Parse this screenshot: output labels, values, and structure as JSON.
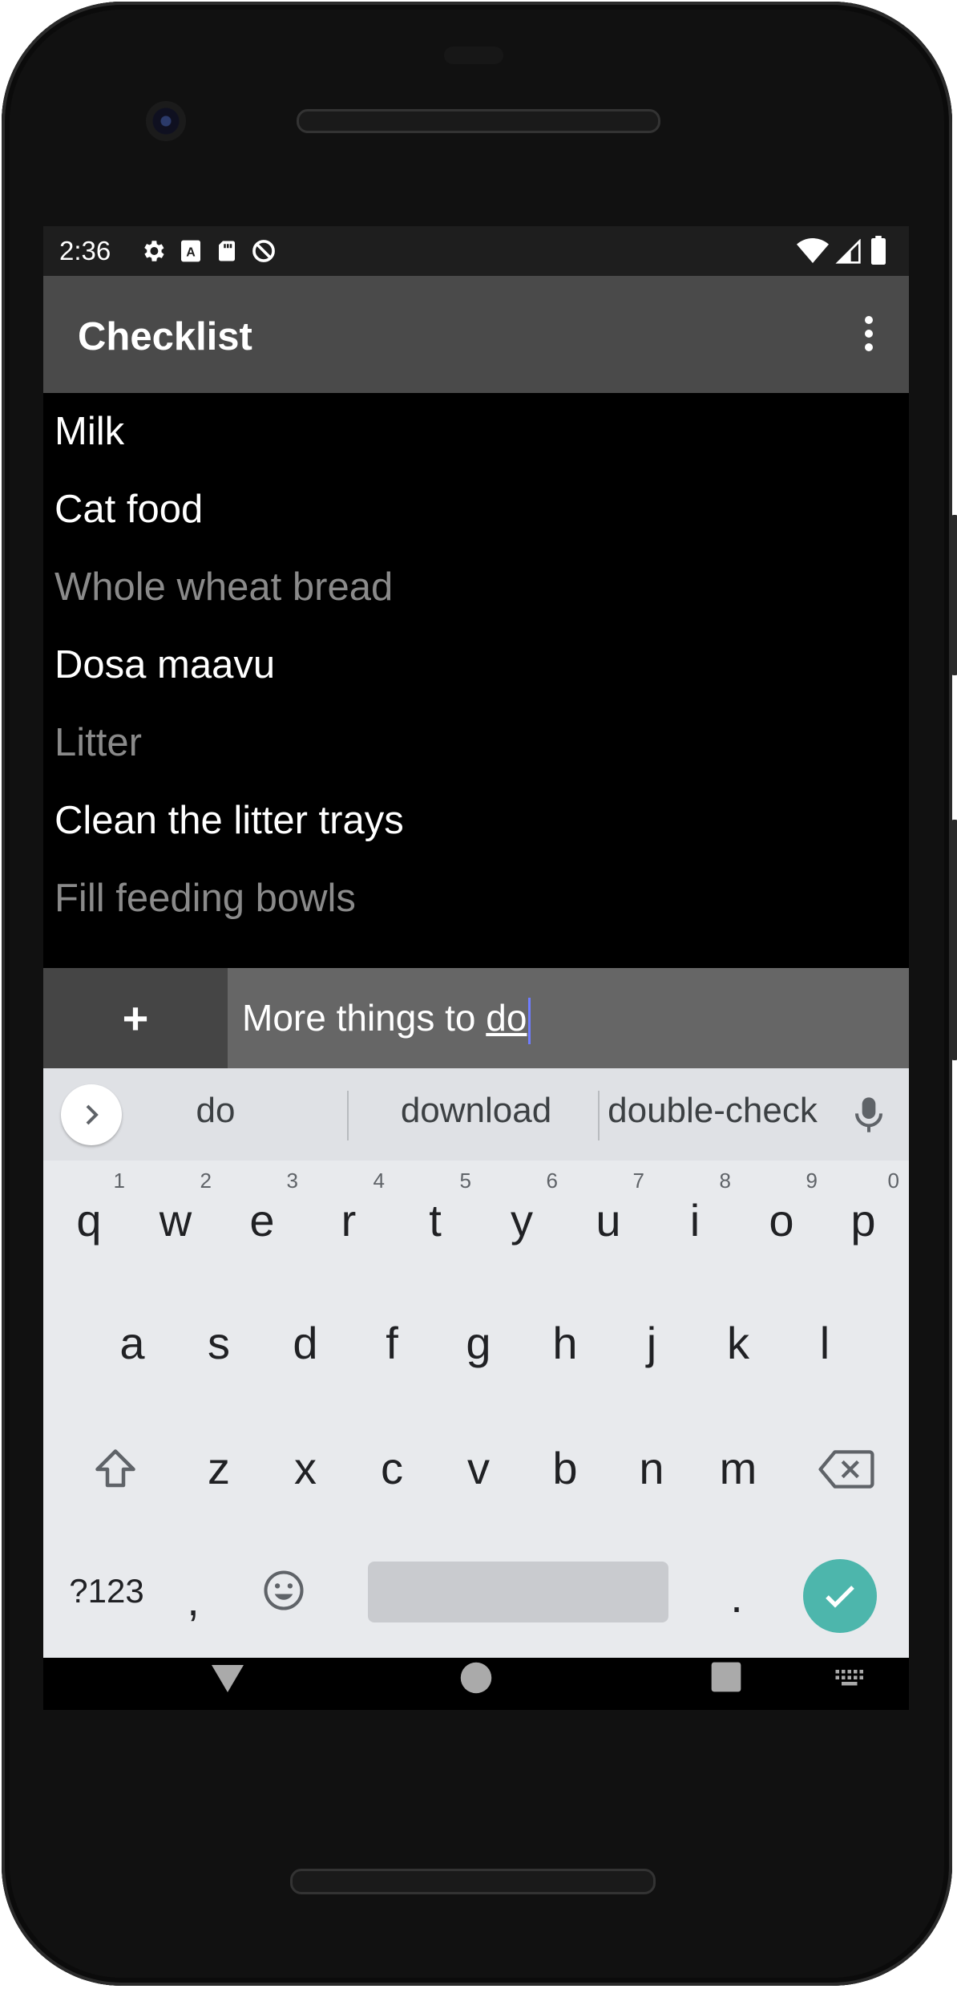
{
  "status_bar": {
    "time": "2:36",
    "left_icons": [
      "gear-icon",
      "a-keyboard-icon",
      "sd-card-icon",
      "no-sync-icon"
    ],
    "right_icons": [
      "wifi-icon",
      "signal-icon",
      "battery-icon"
    ]
  },
  "app_bar": {
    "title": "Checklist",
    "menu_icon": "more-vert-icon"
  },
  "list": {
    "items": [
      {
        "label": "Milk",
        "checked": false
      },
      {
        "label": "Cat food",
        "checked": false
      },
      {
        "label": "Whole wheat bread",
        "checked": true
      },
      {
        "label": "Dosa maavu",
        "checked": false
      },
      {
        "label": "Litter",
        "checked": true
      },
      {
        "label": "Clean the litter trays",
        "checked": false
      },
      {
        "label": "Fill feeding bowls",
        "checked": true
      }
    ]
  },
  "add_bar": {
    "add_label": "+",
    "input_prefix": "More things to ",
    "input_composing": "do"
  },
  "keyboard": {
    "suggestions": [
      "do",
      "download",
      "double-check"
    ],
    "row1": [
      "q",
      "w",
      "e",
      "r",
      "t",
      "y",
      "u",
      "i",
      "o",
      "p"
    ],
    "row1_hints": [
      "1",
      "2",
      "3",
      "4",
      "5",
      "6",
      "7",
      "8",
      "9",
      "0"
    ],
    "row2": [
      "a",
      "s",
      "d",
      "f",
      "g",
      "h",
      "j",
      "k",
      "l"
    ],
    "row3": [
      "z",
      "x",
      "c",
      "v",
      "b",
      "n",
      "m"
    ],
    "symbols_label": "?123",
    "comma": ",",
    "period": ".",
    "accent_color": "#4db6ac"
  },
  "nav_bar": {
    "icons": [
      "back-icon",
      "home-icon",
      "recents-icon",
      "keyboard-switch-icon"
    ]
  }
}
